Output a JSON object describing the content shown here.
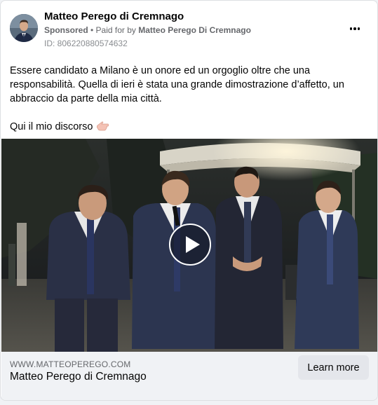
{
  "post": {
    "author_name": "Matteo Perego di Cremnago",
    "sponsored_label": "Sponsored",
    "separator": " • ",
    "paid_for_prefix": "Paid for by ",
    "paid_for_name": "Matteo Perego Di Cremnago",
    "ad_id": "ID: 806220880574632",
    "body_line_1": "Essere candidato a Milano è un onore ed un orgoglio oltre che una responsabilità. Quella di ieri è stata una grande dimostrazione d’affetto, un abbraccio da parte della mia città.",
    "body_line_2": "Qui il mio discorso",
    "emoji_icon": "backhand-pointing-left-icon"
  },
  "footer": {
    "domain": "WWW.MATTEOPEREGO.COM",
    "title": "Matteo Perego di Cremnago",
    "cta_label": "Learn more"
  },
  "colors": {
    "secondary_text": "#65676b",
    "footer_bg": "#f0f2f5",
    "button_bg": "#e4e6eb"
  }
}
